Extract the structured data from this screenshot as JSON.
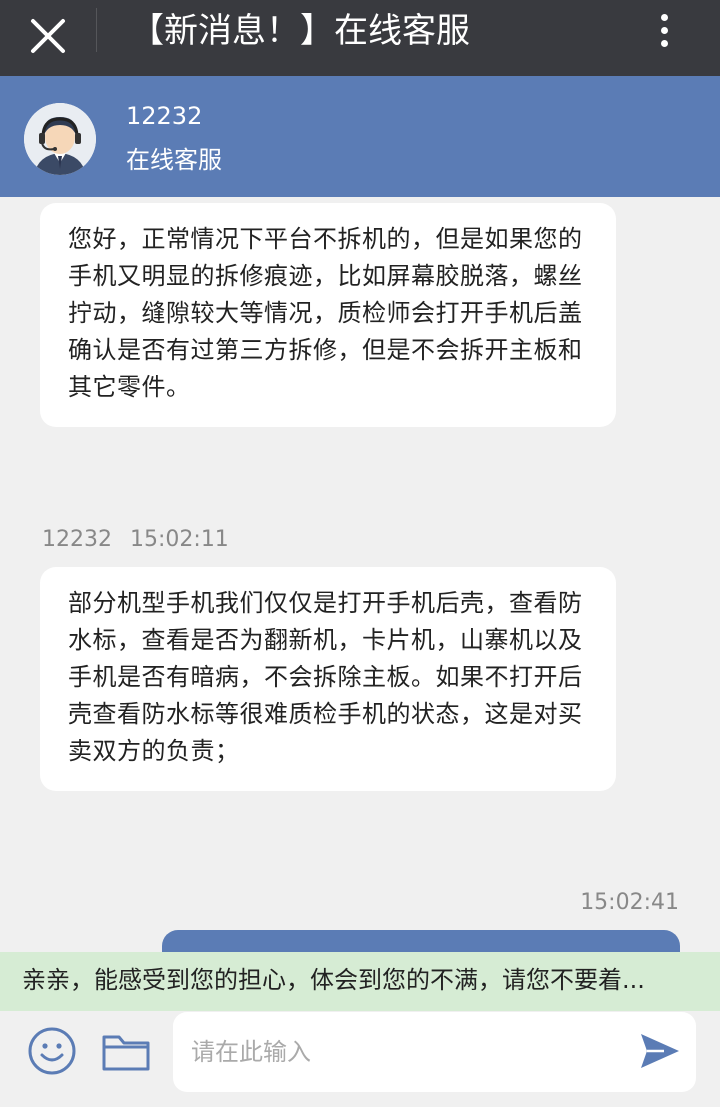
{
  "topbar": {
    "title": "【新消息！】在线客服",
    "close_icon": "close-icon",
    "more_icon": "more-vertical-icon"
  },
  "agent": {
    "id": "12232",
    "role": "在线客服",
    "avatar_icon": "agent-headset-avatar"
  },
  "messages": [
    {
      "text": "您好，正常情况下平台不拆机的，但是如果您的手机又明显的拆修痕迹，比如屏幕胶脱落，螺丝拧动，缝隙较大等情况，质检师会打开手机后盖确认是否有过第三方拆修，但是不会拆开主板和其它零件。"
    },
    {
      "sender": "12232",
      "time": "15:02:11",
      "text": "部分机型手机我们仅仅是打开手机后壳，查看防水标，查看是否为翻新机，卡片机，山寨机以及手机是否有暗病，不会拆除主板。如果不打开后壳查看防水标等很难质检手机的状态，这是对买卖双方的负责；"
    },
    {
      "time": "15:02:41"
    }
  ],
  "notice": {
    "text": "亲亲，能感受到您的担心，体会到您的不满，请您不要着..."
  },
  "input": {
    "placeholder": "请在此输入",
    "emoji_icon": "emoji-icon",
    "folder_icon": "folder-icon",
    "send_icon": "send-icon"
  },
  "colors": {
    "topbar": "#393a3f",
    "header": "#5b7cb5",
    "notice_bg": "#d6ecd4",
    "chat_bg": "#f0f0f0",
    "icon": "#5b7cb5"
  }
}
